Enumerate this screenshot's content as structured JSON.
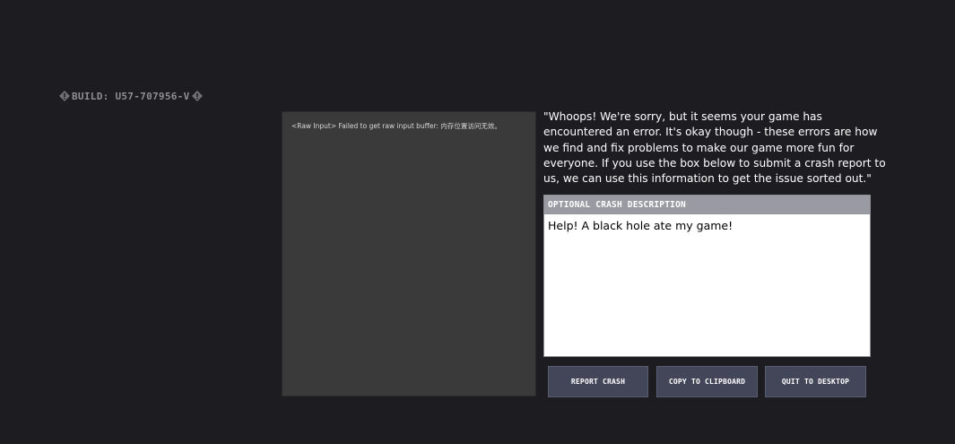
{
  "build": {
    "label": "BUILD: U57-707956-V"
  },
  "log": {
    "lines": [
      "<Raw Input> Failed to get raw input buffer: 内存位置访问无效。"
    ]
  },
  "message": {
    "text": "\"Whoops! We're sorry, but it seems your game has encountered an error. It's okay though - these errors are how we find and fix problems to make our game more fun for everyone. If you use the box below to submit a crash report to us, we can use this information to get the issue sorted out.\""
  },
  "description": {
    "header": "OPTIONAL CRASH DESCRIPTION",
    "value": "Help! A black hole ate my game!"
  },
  "buttons": {
    "report": "REPORT CRASH",
    "copy": "COPY TO CLIPBOARD",
    "quit": "QUIT TO DESKTOP"
  },
  "colors": {
    "background": "#1c1c21",
    "panel": "#3a3a3a",
    "button": "#434659",
    "header": "#9a9aa2"
  },
  "icons": {
    "build_left": "diamond-icon",
    "build_right": "diamond-icon"
  }
}
